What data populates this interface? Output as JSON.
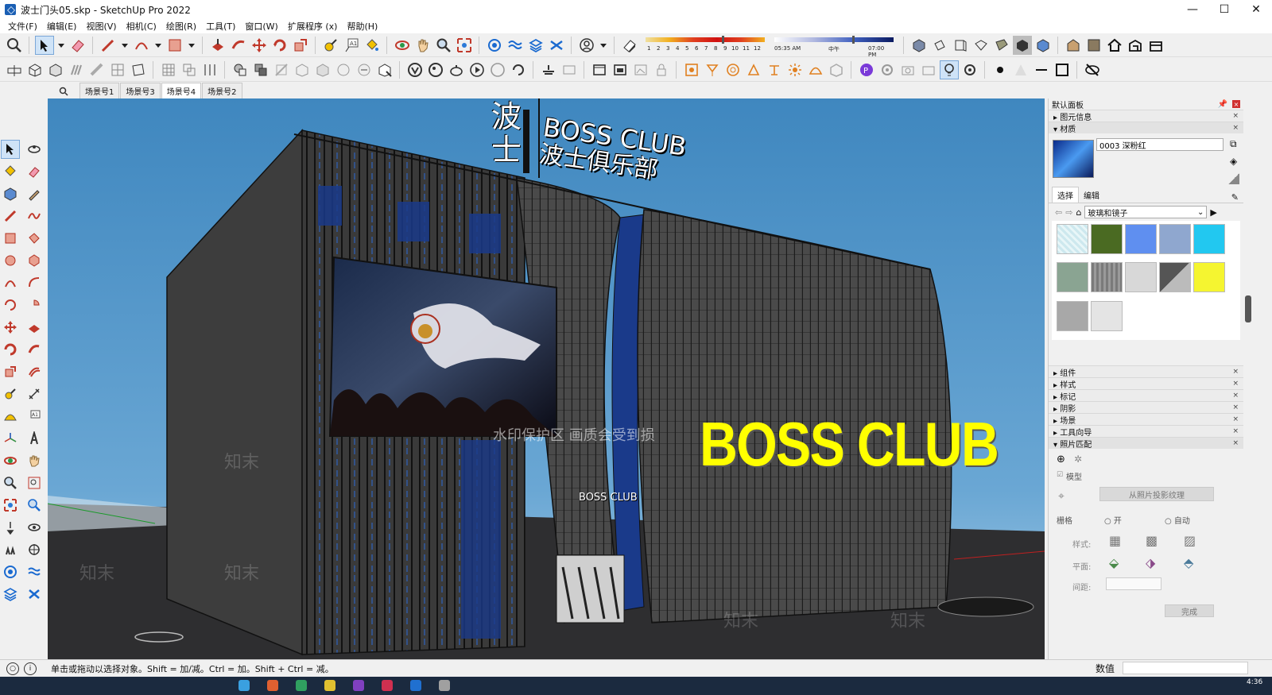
{
  "window": {
    "title": "波士门头05.skp - SketchUp Pro 2022",
    "minimize": "—",
    "maximize": "☐",
    "close": "✕"
  },
  "menu": [
    "文件(F)",
    "编辑(E)",
    "视图(V)",
    "相机(C)",
    "绘图(R)",
    "工具(T)",
    "窗口(W)",
    "扩展程序 (x)",
    "帮助(H)"
  ],
  "shadow": {
    "months": [
      "1",
      "2",
      "3",
      "4",
      "5",
      "6",
      "7",
      "8",
      "9",
      "10",
      "11",
      "12"
    ],
    "time_start": "05:35 AM",
    "time_mid": "中午",
    "time_end": "07:00 PM"
  },
  "scenes": {
    "tabs": [
      "场景号1",
      "场景号3",
      "场景号4",
      "场景号2"
    ],
    "active_index": 2
  },
  "scene_model": {
    "vertical_sign_chars": [
      "波",
      "士"
    ],
    "top_sign_line1": "BOSS CLUB",
    "top_sign_line2": "波士俱乐部",
    "side_sign": "BOSS CLUB",
    "entrance_sign": "BOSS CLUB",
    "watermark_text": "知末",
    "watermark_banner": "水印保护区  画质会受到损",
    "colors": {
      "sky": "#4f8fbe",
      "facade": "#3a3a3a",
      "sign_yellow": "#ffff00",
      "glass_blue": "#1a3a8a"
    }
  },
  "panel": {
    "title": "默认面板",
    "sections_top": [
      "图元信息",
      "材质"
    ],
    "material_name": "0003 深粉红",
    "tab_select": "选择",
    "tab_edit": "编辑",
    "library": "玻璃和镜子",
    "swatch_colors": [
      "#cde8ee",
      "#4a6a22",
      "#5f8ff0",
      "#8fa7cf",
      "#22c8f0",
      "#8aa492",
      "#8a8a8a",
      "#d8d8d8",
      "#9a9a9a",
      "#f5f530",
      "#a8a8a8",
      "#e4e4e4"
    ],
    "sections_collapsed": [
      "组件",
      "样式",
      "标记",
      "阴影",
      "场景",
      "工具向导"
    ],
    "photo_match": "照片匹配",
    "model_label": "模型",
    "from_photo_btn": "从照片投影纹理",
    "grid_label": "栅格",
    "grid_on": "开",
    "grid_auto": "自动",
    "style_label": "样式:",
    "plane_label": "平面:",
    "spacing_label": "间距:",
    "done_btn": "完成"
  },
  "status": {
    "hint": "单击或拖动以选择对象。Shift = 加/减。Ctrl = 加。Shift + Ctrl = 减。",
    "value_label": "数值"
  },
  "taskbar": {
    "clock": "4:36"
  }
}
